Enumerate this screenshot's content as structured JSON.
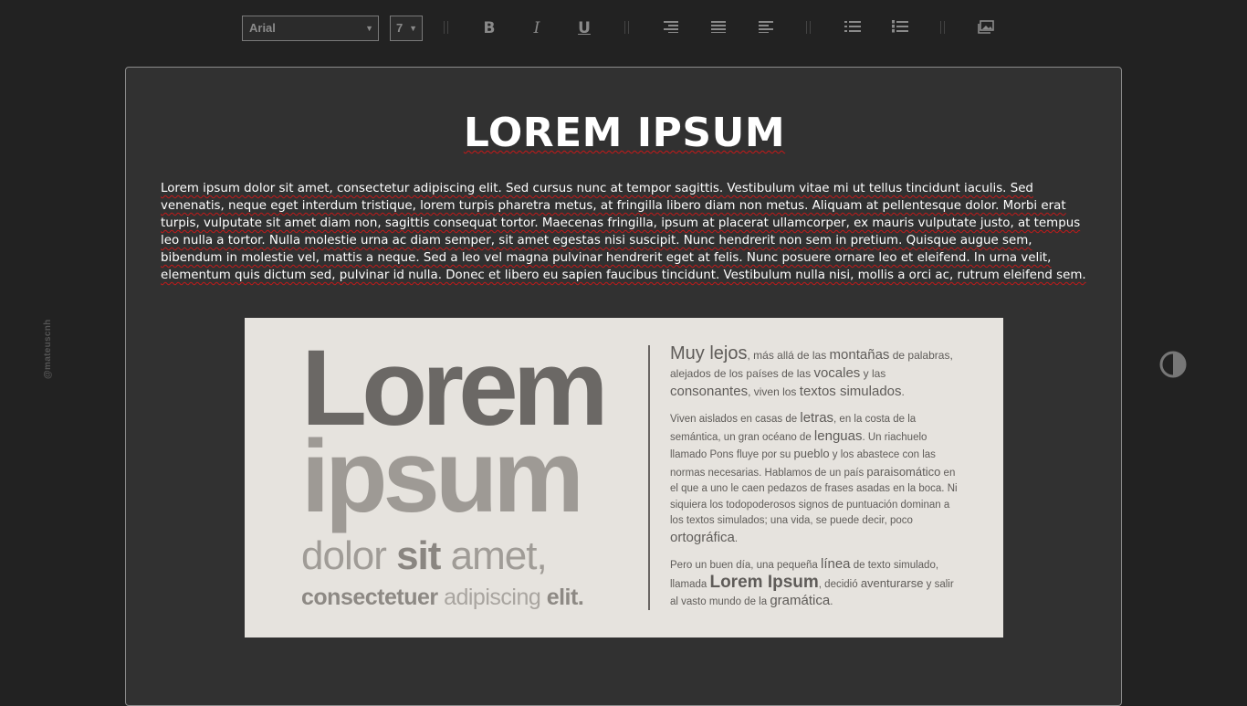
{
  "toolbar": {
    "font_value": "Arial",
    "size_value": "7",
    "buttons": [
      "bold-icon",
      "italic-icon",
      "underline-icon",
      "align-right-icon",
      "justify-icon",
      "align-left-icon",
      "bullet-list-icon",
      "numbered-list-icon",
      "insert-image-icon"
    ],
    "bold_glyph": "B",
    "italic_glyph": "I",
    "underline_glyph": "U"
  },
  "document": {
    "title": "LOREM IPSUM",
    "body": "Lorem ipsum dolor sit amet, consectetur adipiscing elit. Sed cursus nunc at tempor sagittis. Vestibulum vitae mi ut tellus tincidunt iaculis. Sed venenatis, neque eget interdum tristique, lorem turpis pharetra metus, at fringilla libero diam non metus. Aliquam at pellentesque dolor. Morbi erat turpis, vulputate sit amet diam non, sagittis consequat tortor. Maecenas fringilla, ipsum at placerat ullamcorper, ex mauris vulputate justo, at tempus leo nulla a tortor. Nulla molestie urna ac diam semper, sit amet egestas nisi suscipit. Nunc hendrerit non sem in pretium. Quisque augue sem, bibendum in molestie vel, mattis a neque. Sed a leo vel magna pulvinar hendrerit eget at felis. Nunc posuere ornare leo et eleifend. In urna velit, elementum quis dictum sed, pulvinar id nulla. Donec et libero eu sapien faucibus tincidunt. Vestibulum nulla nisi, mollis a orci ac, rutrum eleifend sem."
  },
  "image": {
    "big_line1": "Lorem",
    "big_line2": "ipsum",
    "line3_a": "dolor ",
    "line3_b": "sit",
    "line3_c": " amet,",
    "line4_a": "consectetuer",
    "line4_b": " adipiscing ",
    "line4_c": "elit.",
    "para1_a": "Muy lejos",
    "para1_b": ", más allá de las ",
    "para1_c": "montañas",
    "para1_d": " de palabras, alejados de los países de las ",
    "para1_e": "vocales",
    "para1_f": " y las ",
    "para1_g": "consonantes",
    "para1_h": ", viven los ",
    "para1_i": "textos simulados",
    "para1_j": ".",
    "para2_a": "Viven aislados en casas de ",
    "para2_b": "letras",
    "para2_c": ", en la costa de la semántica, un gran océano de ",
    "para2_d": "lenguas",
    "para2_e": ". Un riachuelo llamado Pons fluye por su ",
    "para2_f": "pueblo",
    "para2_g": " y los abastece con las normas necesarias. Hablamos de un país ",
    "para2_h": "paraisomático",
    "para2_i": " en el que a uno le caen pedazos de frases asadas en la boca. Ni siquiera los todopoderosos signos de puntuación dominan a los textos simulados; una vida, se puede decir, poco ",
    "para2_j": "ortográfica",
    "para2_k": ".",
    "para3_a": "Pero un buen día, una pequeña ",
    "para3_b": "línea",
    "para3_c": " de texto simulado, llamada ",
    "para3_d": "Lorem Ipsum",
    "para3_e": ", decidió ",
    "para3_f": "aventurarse",
    "para3_g": " y salir al vasto mundo de la ",
    "para3_h": "gramática",
    "para3_i": "."
  },
  "side_credit": "@mateuscnh",
  "icons": {
    "contrast": "contrast-toggle-icon"
  }
}
